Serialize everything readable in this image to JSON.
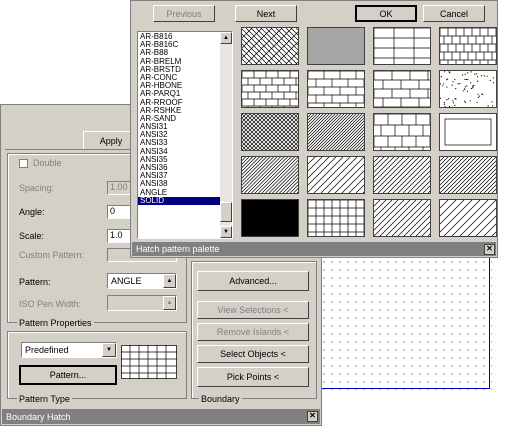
{
  "palette": {
    "title": "Hatch pattern palette",
    "buttons": {
      "previous": "Previous",
      "next": "Next",
      "ok": "OK",
      "cancel": "Cancel"
    },
    "list_items": [
      "AR-B816",
      "AR-B816C",
      "AR-B88",
      "AR-BRELM",
      "AR-BRSTD",
      "AR-CONC",
      "AR-HBONE",
      "AR-PARQ1",
      "AR-RROOF",
      "AR-RSHKE",
      "AR-SAND",
      "ANSI31",
      "ANSI32",
      "ANSI33",
      "ANSI34",
      "ANSI35",
      "ANSI36",
      "ANSI37",
      "ANSI38",
      "ANGLE",
      "SOLID"
    ],
    "selected_item": "SOLID",
    "swatches": [
      "herringbone",
      "parquet",
      "bricks-stacked",
      "shingle",
      "bricks",
      "bricks-running",
      "bricks-english",
      "sand",
      "crosshatch-fine",
      "hatch-dense",
      "blocks",
      "rect-outline",
      "diagonal",
      "diagonal-wide",
      "diagonal-sparse",
      "diagonal-fine",
      "solid",
      "grid",
      "diagonal-light",
      "diagonal-lines"
    ]
  },
  "boundary": {
    "title": "Boundary Hatch",
    "apply_tab": "Apply",
    "double_label": "Double",
    "spacing_label": "Spacing:",
    "spacing_value": "1.00",
    "angle_label": "Angle:",
    "angle_value": "0",
    "scale_label": "Scale:",
    "scale_value": "1.0",
    "custom_label": "Custom Pattern:",
    "pattern_label": "Pattern:",
    "pattern_value": "ANGLE",
    "iso_label": "ISO Pen Width:",
    "props_group": "Pattern Properties",
    "type_group": "Pattern Type",
    "type_value": "Predefined",
    "pattern_btn": "Pattern...",
    "boundary_group": "Boundary",
    "adv_btn": "Advanced...",
    "view_sel_btn": "View Selections <",
    "remove_btn": "Remove Islands <",
    "select_btn": "Select Objects <",
    "pick_btn": "Pick Points <"
  }
}
